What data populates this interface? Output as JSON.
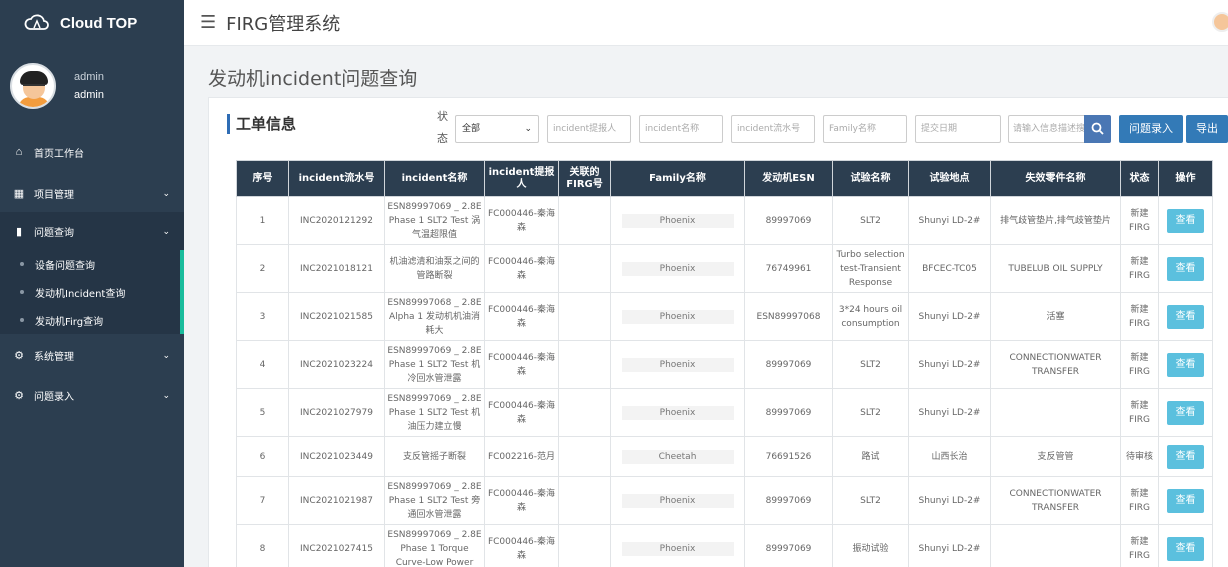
{
  "brand": {
    "name": "Cloud TOP"
  },
  "profile": {
    "name": "admin",
    "role": "admin"
  },
  "menu": {
    "home": "首页工作台",
    "project": "项目管理",
    "problem": "问题查询",
    "sub": [
      "设备问题查询",
      "发动机Incident查询",
      "发动机Firg查询"
    ],
    "system": "系统管理",
    "entry": "问题录入"
  },
  "header": {
    "title": "FIRG管理系统"
  },
  "page": {
    "title": "发动机incident问题查询"
  },
  "panel": {
    "title": "工单信息",
    "status_label": "状态",
    "status_value": "全部",
    "placeholders": {
      "reporter": "incident提报人",
      "name": "incident名称",
      "serial": "incident流水号",
      "family": "Family名称",
      "date": "提交日期",
      "search": "请输入信息描述搜索"
    },
    "btn_entry": "问题录入",
    "btn_export": "导出"
  },
  "table": {
    "headers": [
      "序号",
      "incident流水号",
      "incident名称",
      "incident提报人",
      "关联的FIRG号",
      "Family名称",
      "发动机ESN",
      "试验名称",
      "试验地点",
      "失效零件名称",
      "状态",
      "操作"
    ],
    "view_label": "查看",
    "rows": [
      [
        "1",
        "INC2020121292",
        "ESN89997069 _ 2.8E Phase 1 SLT2 Test 涡气温超限值",
        "FC000446-秦海森",
        "",
        "Phoenix",
        "89997069",
        "SLT2",
        "Shunyi LD-2#",
        "排气歧管垫片,排气歧管垫片",
        "新建FIRG"
      ],
      [
        "2",
        "INC2021018121",
        "机油滤清和油泵之间的管路断裂",
        "FC000446-秦海森",
        "",
        "Phoenix",
        "76749961",
        "Turbo selection test-Transient Response",
        "BFCEC-TC05",
        "TUBELUB OIL SUPPLY",
        "新建FIRG"
      ],
      [
        "3",
        "INC2021021585",
        "ESN89997068 _ 2.8E Alpha 1 发动机机油消耗大",
        "FC000446-秦海森",
        "",
        "Phoenix",
        "ESN89997068",
        "3*24 hours oil consumption",
        "Shunyi LD-2#",
        "活塞",
        "新建FIRG"
      ],
      [
        "4",
        "INC2021023224",
        "ESN89997069 _ 2.8E Phase 1 SLT2 Test 机冷回水管泄露",
        "FC000446-秦海森",
        "",
        "Phoenix",
        "89997069",
        "SLT2",
        "Shunyi LD-2#",
        "CONNECTIONWATER TRANSFER",
        "新建FIRG"
      ],
      [
        "5",
        "INC2021027979",
        "ESN89997069 _ 2.8E Phase 1 SLT2 Test 机油压力建立慢",
        "FC000446-秦海森",
        "",
        "Phoenix",
        "89997069",
        "SLT2",
        "Shunyi LD-2#",
        "",
        "新建FIRG"
      ],
      [
        "6",
        "INC2021023449",
        "支反管摇子断裂",
        "FC002216-范月",
        "",
        "Cheetah",
        "76691526",
        "路试",
        "山西长治",
        "支反管管",
        "待审核"
      ],
      [
        "7",
        "INC2021021987",
        "ESN89997069 _ 2.8E Phase 1 SLT2 Test 旁通回水管泄露",
        "FC000446-秦海森",
        "",
        "Phoenix",
        "89997069",
        "SLT2",
        "Shunyi LD-2#",
        "CONNECTIONWATER TRANSFER",
        "新建FIRG"
      ],
      [
        "8",
        "INC2021027415",
        "ESN89997069 _ 2.8E Phase 1 Torque Curve-Low Power",
        "FC000446-秦海森",
        "",
        "Phoenix",
        "89997069",
        "振动试验",
        "Shunyi LD-2#",
        "",
        "新建FIRG"
      ]
    ]
  },
  "colors": {
    "sidebar": "#2c3e50",
    "accent": "#1abc9c",
    "primary": "#337ab7",
    "view": "#5bc0de"
  }
}
